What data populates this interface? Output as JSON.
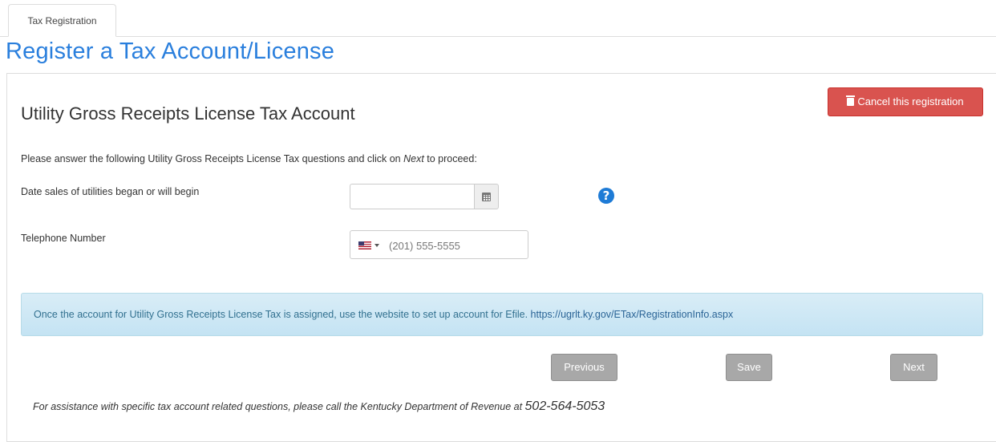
{
  "tabs": [
    {
      "label": "Tax Registration"
    }
  ],
  "page_title": "Register a Tax Account/License",
  "cancel_button": {
    "label": "Cancel this registration"
  },
  "section_title": "Utility Gross Receipts License Tax Account",
  "instructions": {
    "before": "Please answer the following Utility Gross Receipts License Tax questions and click on ",
    "emphasis": "Next",
    "after": " to proceed:"
  },
  "fields": {
    "date_label": "Date sales of utilities began or will begin",
    "date_value": "",
    "phone_label": "Telephone Number",
    "phone_placeholder": "(201) 555-5555",
    "phone_country_icon": "us-flag-icon"
  },
  "info": {
    "text": "Once the account for Utility Gross Receipts License Tax is assigned, use the website to set up account for Efile.",
    "link": "https://ugrlt.ky.gov/ETax/RegistrationInfo.aspx"
  },
  "buttons": {
    "previous": "Previous",
    "save": "Save",
    "next": "Next"
  },
  "assistance": {
    "text": "For assistance with specific tax account related questions, please call the Kentucky Department of Revenue at ",
    "phone": "502-564-5053"
  },
  "colors": {
    "title_blue": "#2a7fdd",
    "danger": "#d9534f",
    "info_bg": "#d9edf7",
    "info_text": "#31708f",
    "disabled_button": "#a8a8a8",
    "help_icon": "#1e7bd6"
  }
}
